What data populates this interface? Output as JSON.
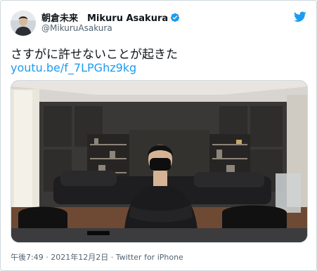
{
  "tweet": {
    "display_name": "朝倉未来　Mikuru Asakura",
    "handle": "@MikuruAsakura",
    "text": "さすがに許せないことが起きた",
    "link": "youtu.be/f_7LPGhz9kg",
    "time": "午後7:49",
    "separator": " · ",
    "date": "2021年12月2日",
    "source": "Twitter for iPhone"
  },
  "colors": {
    "link": "#1d9bf0",
    "verified": "#1d9bf0",
    "secondary_text": "#536471"
  },
  "icons": {
    "verified": "verified-badge",
    "brand": "twitter-bird"
  }
}
